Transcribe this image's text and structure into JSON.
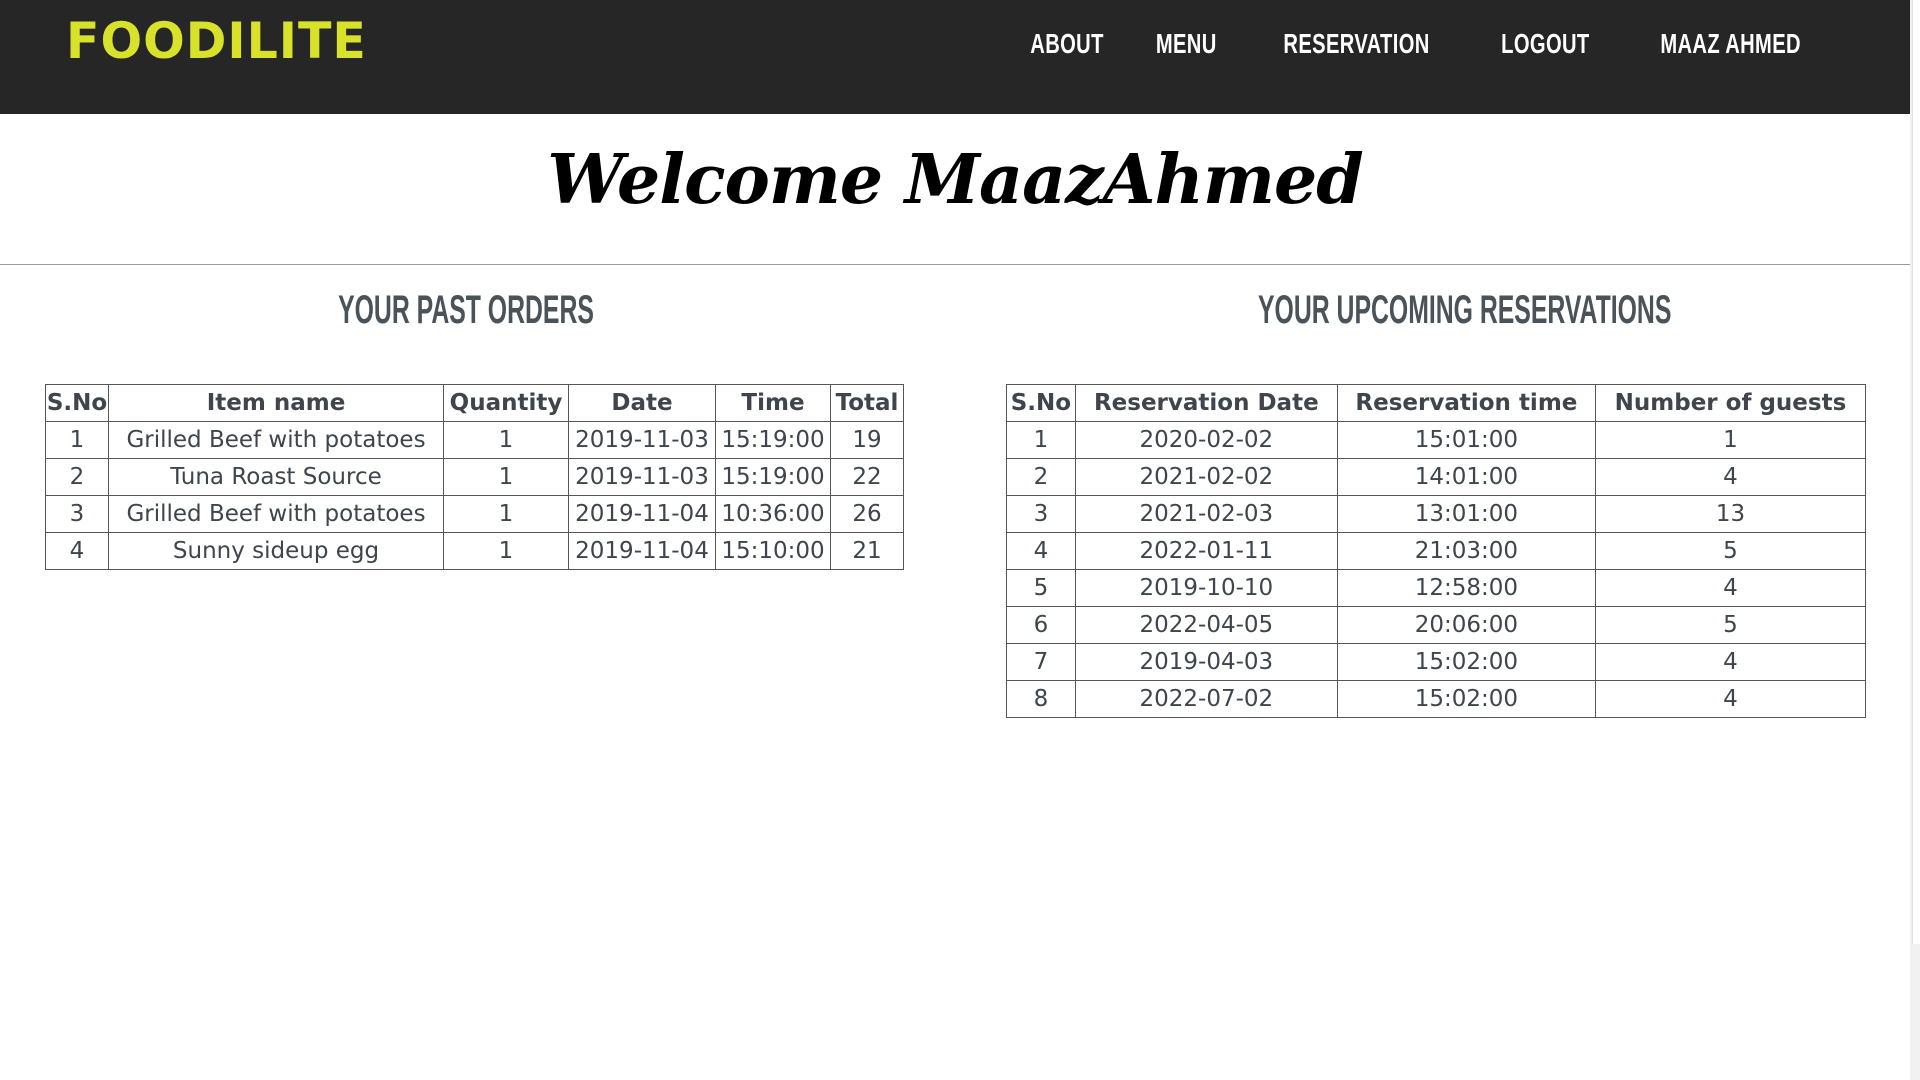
{
  "header": {
    "logo": "FOODILITE",
    "nav": [
      "ABOUT",
      "MENU",
      "RESERVATION",
      "LOGOUT",
      "MAAZ AHMED"
    ]
  },
  "welcome": "Welcome MaazAhmed",
  "past_orders": {
    "title": "YOUR PAST ORDERS",
    "columns": [
      "S.No",
      "Item name",
      "Quantity",
      "Date",
      "Time",
      "Total"
    ],
    "rows": [
      [
        "1",
        "Grilled Beef with potatoes",
        "1",
        "2019-11-03",
        "15:19:00",
        "19"
      ],
      [
        "2",
        "Tuna Roast Source",
        "1",
        "2019-11-03",
        "15:19:00",
        "22"
      ],
      [
        "3",
        "Grilled Beef with potatoes",
        "1",
        "2019-11-04",
        "10:36:00",
        "26"
      ],
      [
        "4",
        "Sunny sideup egg",
        "1",
        "2019-11-04",
        "15:10:00",
        "21"
      ]
    ]
  },
  "reservations": {
    "title": "YOUR UPCOMING RESERVATIONS",
    "columns": [
      "S.No",
      "Reservation Date",
      "Reservation time",
      "Number of guests"
    ],
    "rows": [
      [
        "1",
        "2020-02-02",
        "15:01:00",
        "1"
      ],
      [
        "2",
        "2021-02-02",
        "14:01:00",
        "4"
      ],
      [
        "3",
        "2021-02-03",
        "13:01:00",
        "13"
      ],
      [
        "4",
        "2022-01-11",
        "21:03:00",
        "5"
      ],
      [
        "5",
        "2019-10-10",
        "12:58:00",
        "4"
      ],
      [
        "6",
        "2022-04-05",
        "20:06:00",
        "5"
      ],
      [
        "7",
        "2019-04-03",
        "15:02:00",
        "4"
      ],
      [
        "8",
        "2022-07-02",
        "15:02:00",
        "4"
      ]
    ]
  },
  "colors": {
    "header_bg": "#262626",
    "logo": "#d8e22b",
    "heading": "#4a525a",
    "table_text": "#3e454c"
  }
}
